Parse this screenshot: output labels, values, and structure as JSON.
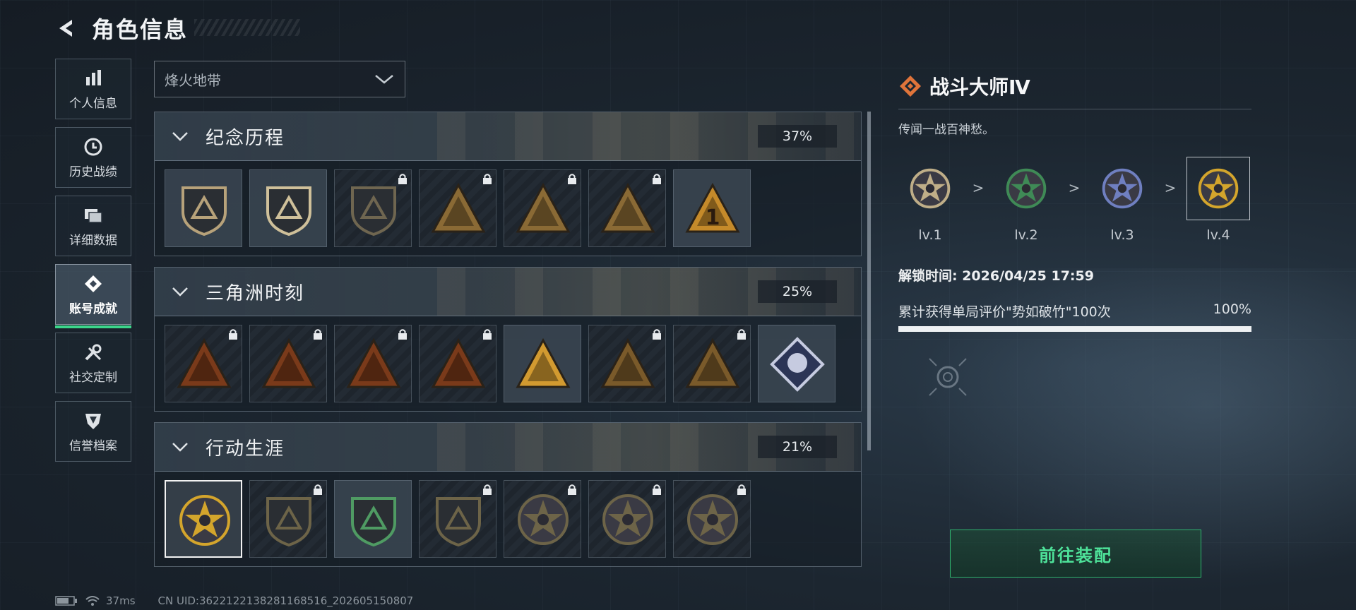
{
  "header": {
    "title": "角色信息"
  },
  "nav": {
    "items": [
      {
        "label": "个人信息",
        "icon": "bar-chart-icon"
      },
      {
        "label": "历史战绩",
        "icon": "clock-icon"
      },
      {
        "label": "详细数据",
        "icon": "folder-icon"
      },
      {
        "label": "账号成就",
        "icon": "achievement-icon",
        "active": true
      },
      {
        "label": "社交定制",
        "icon": "tools-icon"
      },
      {
        "label": "信誉档案",
        "icon": "shield-icon"
      }
    ]
  },
  "filter": {
    "selected": "烽火地带"
  },
  "sections": [
    {
      "title": "纪念历程",
      "percent": "37%",
      "badges": [
        {
          "name": "triangle-a-badge",
          "locked": false,
          "color": "#b7a27a",
          "shape": "shield"
        },
        {
          "name": "helicopter-badge",
          "locked": false,
          "color": "#cfc09a",
          "shape": "shield"
        },
        {
          "name": "diamond-badge",
          "locked": true,
          "color": "#6f6650",
          "shape": "shield"
        },
        {
          "name": "gunner-badge",
          "locked": true,
          "color": "#8a6a35",
          "shape": "triangle"
        },
        {
          "name": "hood-badge",
          "locked": true,
          "color": "#8a6a35",
          "shape": "triangle"
        },
        {
          "name": "crossed-swords-badge",
          "locked": true,
          "color": "#8a6a35",
          "shape": "triangle"
        },
        {
          "name": "number-one-badge",
          "locked": false,
          "color": "#c58a2a",
          "shape": "triangle",
          "text": "1"
        }
      ]
    },
    {
      "title": "三角洲时刻",
      "percent": "25%",
      "badges": [
        {
          "name": "robot-badge",
          "locked": true,
          "color": "#7a3a1a",
          "shape": "triangle"
        },
        {
          "name": "skull-badge",
          "locked": true,
          "color": "#7a3a1a",
          "shape": "triangle"
        },
        {
          "name": "soldier-badge",
          "locked": true,
          "color": "#7a3a1a",
          "shape": "triangle"
        },
        {
          "name": "fist-badge",
          "locked": true,
          "color": "#7a3a1a",
          "shape": "triangle"
        },
        {
          "name": "squad-gold-badge",
          "locked": false,
          "color": "#d29a30",
          "shape": "triangle"
        },
        {
          "name": "squad-badge",
          "locked": true,
          "color": "#7a5a2a",
          "shape": "triangle"
        },
        {
          "name": "beast-badge",
          "locked": true,
          "color": "#7a5a2a",
          "shape": "triangle"
        },
        {
          "name": "rose-badge",
          "locked": false,
          "color": "#c6cbe0",
          "shape": "diamond"
        }
      ]
    },
    {
      "title": "行动生涯",
      "percent": "21%",
      "badges": [
        {
          "name": "combat-master-badge",
          "locked": false,
          "selected": true,
          "color": "#d4a52c",
          "shape": "round"
        },
        {
          "name": "chevron-shield-badge",
          "locked": true,
          "color": "#6d6448",
          "shape": "shield"
        },
        {
          "name": "green-shield-badge",
          "locked": false,
          "color": "#4f9b63",
          "shape": "shield"
        },
        {
          "name": "d20-badge",
          "locked": true,
          "color": "#6d6448",
          "shape": "shield"
        },
        {
          "name": "helmet-badge",
          "locked": true,
          "color": "#6d6448",
          "shape": "round"
        },
        {
          "name": "crosshair-badge",
          "locked": true,
          "color": "#6d6448",
          "shape": "round"
        },
        {
          "name": "eye-badge",
          "locked": true,
          "color": "#6d6448",
          "shape": "round"
        }
      ]
    }
  ],
  "detail": {
    "title": "战斗大师Ⅳ",
    "description": "传闻一战百神愁。",
    "levels": [
      {
        "label": "lv.1",
        "color": "#bfae88"
      },
      {
        "label": "lv.2",
        "color": "#3f8a56"
      },
      {
        "label": "lv.3",
        "color": "#6f7fc0"
      },
      {
        "label": "lv.4",
        "color": "#d4a52c"
      }
    ],
    "separator": ">",
    "unlock_time": "解锁时间: 2026/04/25 17:59",
    "requirement": "累计获得单局评价\"势如破竹\"100次",
    "requirement_percent": "100%",
    "progress": 1.0,
    "equip_label": "前往装配"
  },
  "footer": {
    "ping": "37ms",
    "uid": "CN UID:3622122138281168516_202605150807"
  },
  "colors": {
    "accent": "#3cd68b",
    "diamond_icon": "#e0743a"
  }
}
